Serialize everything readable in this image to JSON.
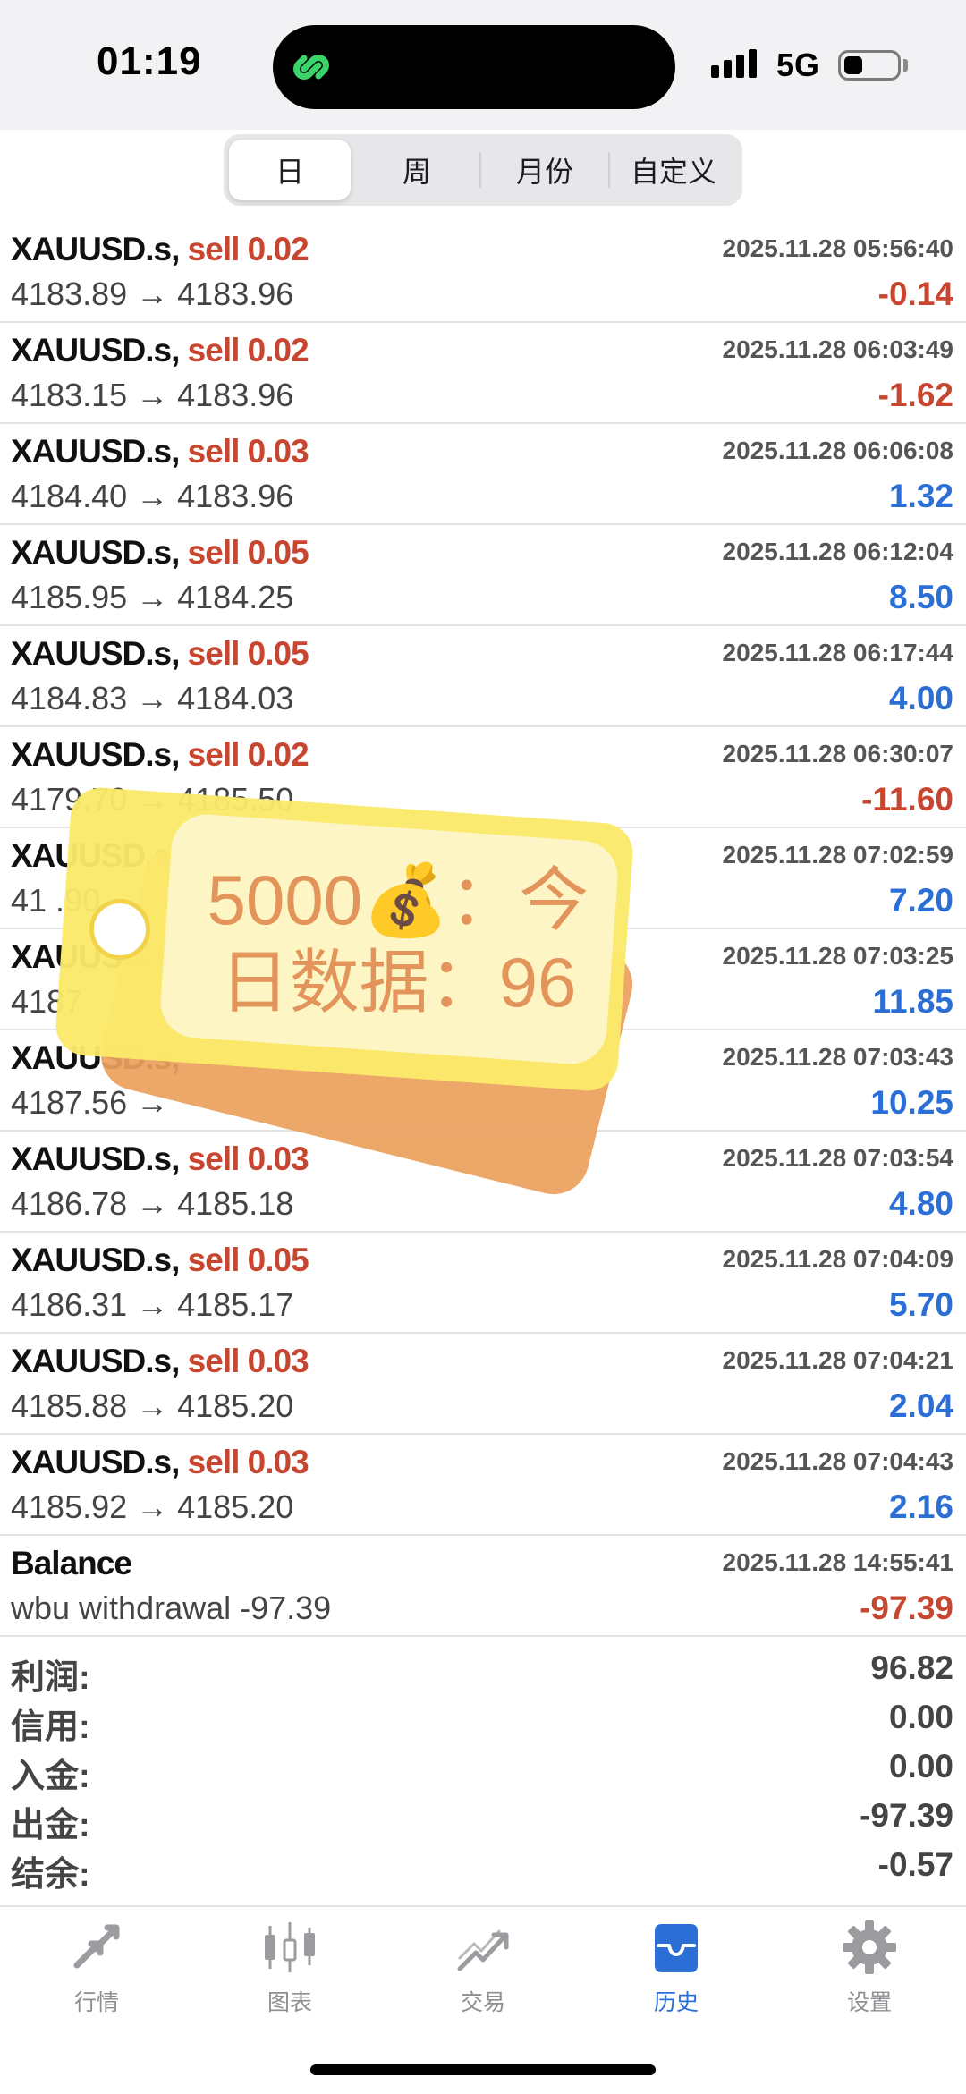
{
  "status_bar": {
    "time": "01:19",
    "network": "5G"
  },
  "segments": {
    "items": [
      "日",
      "周",
      "月份",
      "自定义"
    ],
    "active": "日"
  },
  "trades": [
    {
      "symbol": "XAUUSD.s,",
      "side": "sell 0.02",
      "time": "2025.11.28 05:56:40",
      "prices": "4183.89 → 4183.96",
      "profit": "-0.14"
    },
    {
      "symbol": "XAUUSD.s,",
      "side": "sell 0.02",
      "time": "2025.11.28 06:03:49",
      "prices": "4183.15 → 4183.96",
      "profit": "-1.62"
    },
    {
      "symbol": "XAUUSD.s,",
      "side": "sell 0.03",
      "time": "2025.11.28 06:06:08",
      "prices": "4184.40 → 4183.96",
      "profit": "1.32"
    },
    {
      "symbol": "XAUUSD.s,",
      "side": "sell 0.05",
      "time": "2025.11.28 06:12:04",
      "prices": "4185.95 → 4184.25",
      "profit": "8.50"
    },
    {
      "symbol": "XAUUSD.s,",
      "side": "sell 0.05",
      "time": "2025.11.28 06:17:44",
      "prices": "4184.83 → 4184.03",
      "profit": "4.00"
    },
    {
      "symbol": "XAUUSD.s,",
      "side": "sell 0.02",
      "time": "2025.11.28 06:30:07",
      "prices": "4179.70 → 4185.50",
      "profit": "-11.60"
    },
    {
      "symbol": "XAUUSD.s,",
      "side": "",
      "time": "2025.11.28 07:02:59",
      "prices": "41 .90",
      "profit": "7.20"
    },
    {
      "symbol": "XAUUSD.s,",
      "side": "",
      "time": "2025.11.28 07:03:25",
      "prices": "4187",
      "profit": "11.85"
    },
    {
      "symbol": "XAUUSD.s,",
      "side": "",
      "time": "2025.11.28 07:03:43",
      "prices": "4187.56 →",
      "profit": "10.25"
    },
    {
      "symbol": "XAUUSD.s,",
      "side": "sell 0.03",
      "time": "2025.11.28 07:03:54",
      "prices": "4186.78 → 4185.18",
      "profit": "4.80"
    },
    {
      "symbol": "XAUUSD.s,",
      "side": "sell 0.05",
      "time": "2025.11.28 07:04:09",
      "prices": "4186.31 → 4185.17",
      "profit": "5.70"
    },
    {
      "symbol": "XAUUSD.s,",
      "side": "sell 0.03",
      "time": "2025.11.28 07:04:21",
      "prices": "4185.88 → 4185.20",
      "profit": "2.04"
    },
    {
      "symbol": "XAUUSD.s,",
      "side": "sell 0.03",
      "time": "2025.11.28 07:04:43",
      "prices": "4185.92 → 4185.20",
      "profit": "2.16"
    },
    {
      "symbol": "Balance",
      "side": "",
      "time": "2025.11.28 14:55:41",
      "prices": "wbu withdrawal -97.39",
      "profit": "-97.39"
    }
  ],
  "summary": [
    {
      "label": "利润:",
      "value": "96.82"
    },
    {
      "label": "信用:",
      "value": "0.00"
    },
    {
      "label": "入金:",
      "value": "0.00"
    },
    {
      "label": "出金:",
      "value": "-97.39"
    },
    {
      "label": "结余:",
      "value": "-0.57"
    }
  ],
  "tabbar": [
    {
      "label": "行情",
      "icon": "quotes-arrows-icon",
      "active": false
    },
    {
      "label": "图表",
      "icon": "candlestick-chart-icon",
      "active": false
    },
    {
      "label": "交易",
      "icon": "trade-trend-icon",
      "active": false
    },
    {
      "label": "历史",
      "icon": "history-inbox-icon",
      "active": true
    },
    {
      "label": "设置",
      "icon": "gear-icon",
      "active": false
    }
  ],
  "sticker": {
    "line1": "5000💰：今",
    "line2": "日数据：96"
  },
  "colors": {
    "profit_positive": "#2b6fd6",
    "profit_negative": "#c8462f",
    "sell": "#c8462f",
    "active_tab": "#2b6fd6",
    "sticker_yellow": "#fbe96a",
    "sticker_orange": "#eba05e"
  }
}
